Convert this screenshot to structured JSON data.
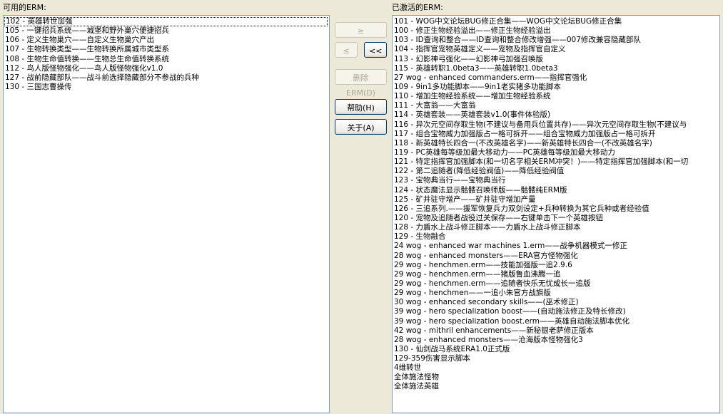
{
  "labels": {
    "available": "可用的ERM:",
    "active": "已激活的ERM:"
  },
  "buttons": {
    "add": "≥",
    "remove": "≤",
    "remove_all": "<<",
    "delete": "删除ERM(D)",
    "help": "帮助(H)",
    "about": "关于(A)"
  },
  "available_items": [
    "102 - 英雄转世加强",
    "105 - 一键招兵系统——城堡和野外巢穴便捷招兵",
    "106 - 定义生物巢穴——自定义生物巢穴产出",
    "107 - 生物转换类型——生物转换所属城市类型系",
    "108 - 生物生命值转换——生物总生命值转换系统",
    "112 - 鸟人版怪物强化——鸟人版怪物强化v1.0",
    "127 - 战前隐藏部队——战斗前选择隐藏部分不参战的兵种",
    "130 - 三国志曹操传"
  ],
  "active_items": [
    "101 - WOG中文论坛BUG修正合集——WOG中文论坛BUG修正合集",
    "100 - 修正生物经验溢出——修正生物经验溢出",
    "103 - ID查询和整合——ID查询和整合修改增强——007修改兼容隐藏部队",
    "104 - 指挥官宠物英雄定义——宠物及指挥官自定义",
    "113 - 幻影神弓强化——幻影神弓加强召唤版",
    "115 - 英雄转职1.0beta3——英雄转职1.0beta3",
    "27 wog - enhanced commanders.erm——指挥官强化",
    "109 - 9in1多功能脚本——9in1老实猪多功能脚本",
    "110 - 增加生物经验系统——增加生物经验系统",
    "111 - 大富翁——大富翁",
    "114 - 英雄套装——英雄套装v1.0(事件体验版)",
    "116 - 异次元空间存取生物(不建议与备用兵位置共存)——异次元空间存取生物(不建议与",
    "117 - 组合宝物威力加强版占一格可拆开——组合宝物威力加强版占一格可拆开",
    "118 - 新英雄特长四合一(不改英雄名字)——新英雄特长四合一(不改英雄名字)",
    "119 - PC英雄每等级加最大移动力——PC英雄每等级加最大移动力",
    "121 - 特定指挥官加强脚本(和一切名字相关ERM冲突！)——特定指挥官加强脚本(和一切",
    "122 - 第二追随者(降低经验阀值)——降低经验阀值",
    "123 - 宝物典当行——宝物典当行",
    "124 - 状态魔法显示骷髅召唤师版——骷髅纯ERM版",
    "125 - 矿井驻守增产——矿井驻守增加产量",
    "126 - 三追系列.——援军恢复兵力双剑设定+兵种转换为其它兵种或者经验值",
    "120 - 宠物及追随者战役过关保存——右键单击下一个英雄按钮",
    "128 - 力盾水上战斗修正脚本——力盾水上战斗修正脚本",
    "129 - 生物融合",
    "24 wog - enhanced war machines 1.erm——战争机器模式一修正",
    "28 wog - enhanced monsters——ERA官方怪物强化",
    "29 wog - henchmen.erm——技能加强版一追2.9.6",
    "29 wog - henchmen.erm——猪版鲁血沸腾一追",
    "29 wog - henchmen.erm——追随者快乐无忧成长一追版",
    "29 wog - henchmen——一追小朱官方战旗版",
    "30 wog - enhanced secondary skills——(巫术修正)",
    "39 wog - hero specialization boost——(自动施法修正及特长修改)",
    "39 wog - hero specialization boost.erm——英雄自动施法脚本优化",
    "42 wog - mithril enhancements——新秘银老萨修正版本",
    "28 wog - enhanced monsters——沧海版本怪物强化3",
    "130 - 仙剑战马系统ERA1.0正式版",
    "129-359伤害显示脚本",
    "4维转世",
    "全体施法怪物",
    "全体施法英雄"
  ]
}
